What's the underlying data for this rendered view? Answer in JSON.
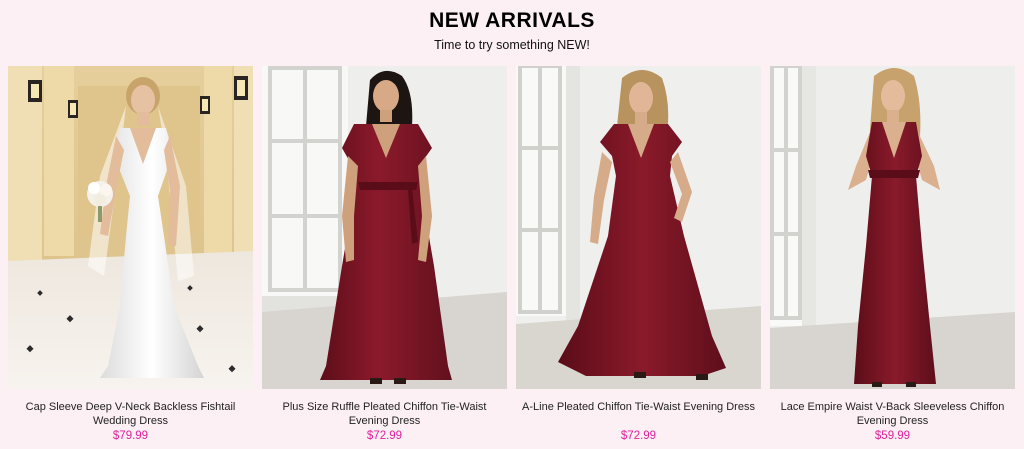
{
  "section": {
    "title": "NEW ARRIVALS",
    "subtitle": "Time to try something NEW!"
  },
  "products": [
    {
      "name": "Cap Sleeve Deep V-Neck Backless Fishtail Wedding Dress",
      "price": "$79.99",
      "image": "white-wedding-dress-photo"
    },
    {
      "name": "Plus Size Ruffle Pleated Chiffon Tie-Waist Evening Dress",
      "price": "$72.99",
      "image": "burgundy-plus-size-dress-photo"
    },
    {
      "name": "A-Line Pleated Chiffon Tie-Waist Evening Dress",
      "price": "$72.99",
      "image": "burgundy-a-line-dress-photo"
    },
    {
      "name": "Lace Empire Waist V-Back Sleeveless Chiffon Evening Dress",
      "price": "$59.99",
      "image": "burgundy-sleeveless-dress-photo"
    }
  ],
  "colors": {
    "background": "#fcf0f5",
    "price": "#e0219a",
    "burgundy": "#7e1424"
  }
}
